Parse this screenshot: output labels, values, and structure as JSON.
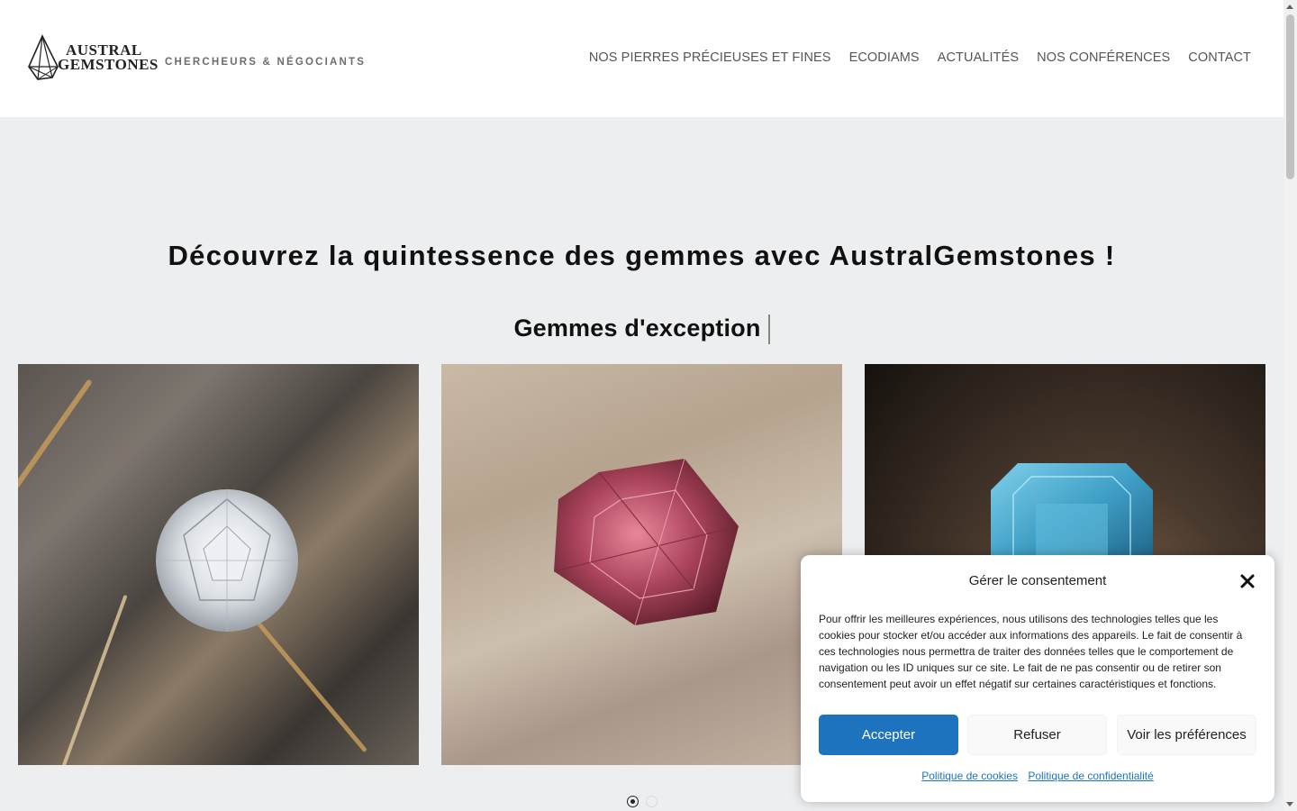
{
  "header": {
    "logo_line1": "AUSTRAL",
    "logo_line2": "GEMSTONES",
    "tagline": "CHERCHEURS & NÉGOCIANTS",
    "nav": [
      {
        "label": "NOS PIERRES PRÉCIEUSES ET FINES"
      },
      {
        "label": "ECODIAMS"
      },
      {
        "label": "ACTUALITÉS"
      },
      {
        "label": "NOS CONFÉRENCES"
      },
      {
        "label": "CONTACT"
      }
    ]
  },
  "hero": {
    "title": "Découvrez la quintessence des gemmes avec AustralGemstones !",
    "subtitle": "Gemmes d'exception"
  },
  "carousel": {
    "total_slides": 2,
    "active_slide": 1
  },
  "consent": {
    "title": "Gérer le consentement",
    "body": "Pour offrir les meilleures expériences, nous utilisons des technologies telles que les cookies pour stocker et/ou accéder aux informations des appareils. Le fait de consentir à ces technologies nous permettra de traiter des données telles que le comportement de navigation ou les ID uniques sur ce site. Le fait de ne pas consentir ou de retirer son consentement peut avoir un effet négatif sur certaines caractéristiques et fonctions.",
    "accept_label": "Accepter",
    "deny_label": "Refuser",
    "prefs_label": "Voir les préférences",
    "cookie_policy_label": "Politique de cookies",
    "privacy_policy_label": "Politique de confidentialité"
  },
  "colors": {
    "accent": "#1e73be",
    "background": "#edeef0"
  }
}
